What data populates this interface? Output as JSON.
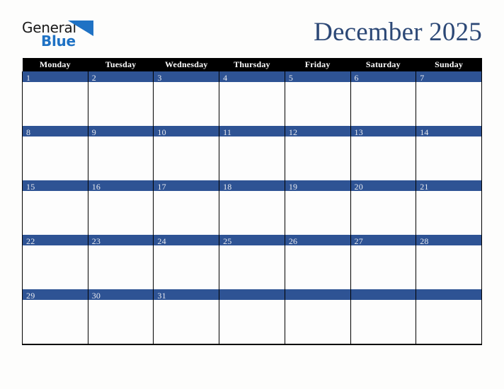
{
  "header": {
    "logo": {
      "line1": "General",
      "line2": "Blue",
      "triangle_icon": "blue-triangle-icon",
      "color_dark": "#1a1a1a",
      "color_blue": "#1f72c4"
    },
    "title": "December 2025",
    "title_color": "#2c4876"
  },
  "calendar": {
    "month": "December",
    "year": "2025",
    "weekday_headers": [
      "Monday",
      "Tuesday",
      "Wednesday",
      "Thursday",
      "Friday",
      "Saturday",
      "Sunday"
    ],
    "header_bg": "#000000",
    "header_text_color": "#ffffff",
    "day_band_color": "#2e5394",
    "day_number_color": "#e8eaf0",
    "cell_bg": "#fdfdfd",
    "grid_line_color": "#000000",
    "weeks": [
      {
        "days": [
          {
            "num": "1"
          },
          {
            "num": "2"
          },
          {
            "num": "3"
          },
          {
            "num": "4"
          },
          {
            "num": "5"
          },
          {
            "num": "6"
          },
          {
            "num": "7"
          }
        ]
      },
      {
        "days": [
          {
            "num": "8"
          },
          {
            "num": "9"
          },
          {
            "num": "10"
          },
          {
            "num": "11"
          },
          {
            "num": "12"
          },
          {
            "num": "13"
          },
          {
            "num": "14"
          }
        ]
      },
      {
        "days": [
          {
            "num": "15"
          },
          {
            "num": "16"
          },
          {
            "num": "17"
          },
          {
            "num": "18"
          },
          {
            "num": "19"
          },
          {
            "num": "20"
          },
          {
            "num": "21"
          }
        ]
      },
      {
        "days": [
          {
            "num": "22"
          },
          {
            "num": "23"
          },
          {
            "num": "24"
          },
          {
            "num": "25"
          },
          {
            "num": "26"
          },
          {
            "num": "27"
          },
          {
            "num": "28"
          }
        ]
      },
      {
        "days": [
          {
            "num": "29"
          },
          {
            "num": "30"
          },
          {
            "num": "31"
          },
          {
            "num": ""
          },
          {
            "num": ""
          },
          {
            "num": ""
          },
          {
            "num": ""
          }
        ]
      }
    ]
  }
}
